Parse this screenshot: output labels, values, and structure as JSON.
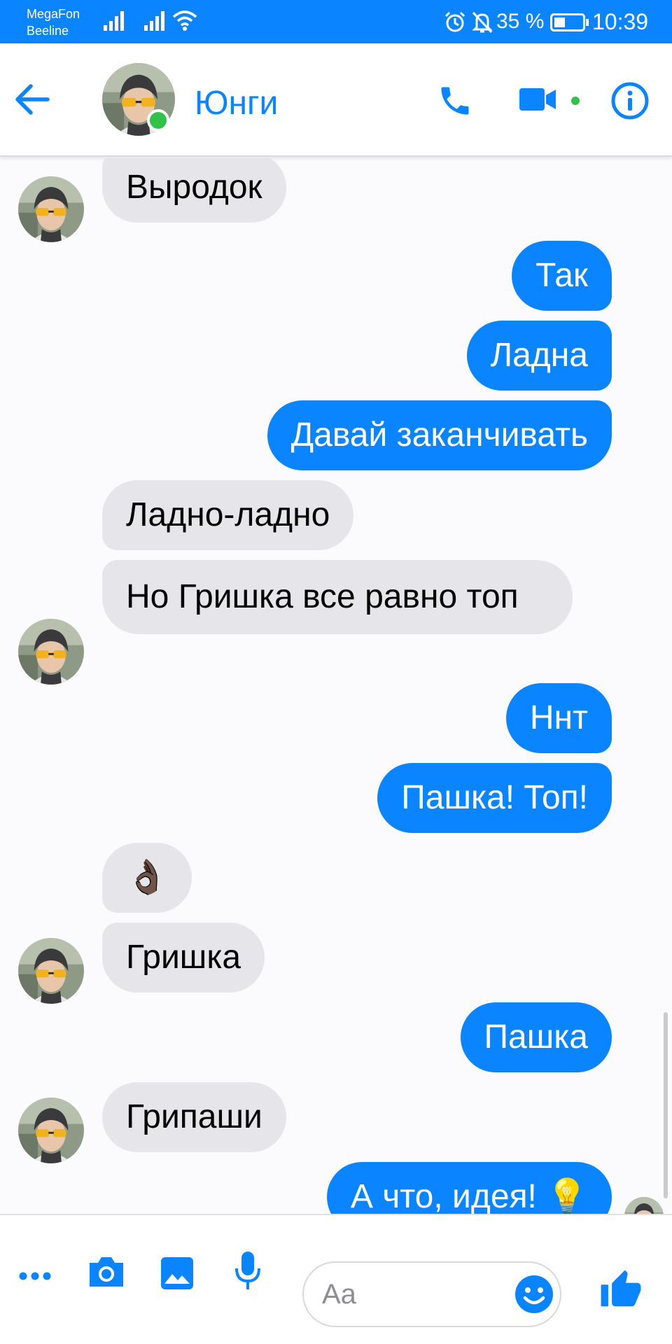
{
  "status_bar": {
    "carrier_1": "MegaFon",
    "carrier_2": "Beeline",
    "battery_percent": "35 %",
    "time": "10:39",
    "icons": [
      "signal-icon",
      "signal-icon",
      "wifi-icon",
      "alarm-icon",
      "notifications-off-icon",
      "battery-icon"
    ]
  },
  "header": {
    "contact_name": "Юнги",
    "online": true,
    "icons": [
      "back-arrow-icon",
      "phone-icon",
      "video-camera-icon",
      "info-icon"
    ]
  },
  "messages": [
    {
      "direction": "in",
      "text": "Выродок"
    },
    {
      "direction": "out",
      "text": "Так"
    },
    {
      "direction": "out",
      "text": "Ладна"
    },
    {
      "direction": "out",
      "text": "Давай заканчивать"
    },
    {
      "direction": "in",
      "text": "Ладно-ладно"
    },
    {
      "direction": "in",
      "text": "Но Гришка все равно топ"
    },
    {
      "direction": "out",
      "text": "Ннт"
    },
    {
      "direction": "out",
      "text": "Пашка! Топ!"
    },
    {
      "direction": "in",
      "text": "👌🏿"
    },
    {
      "direction": "in",
      "text": "Гришка"
    },
    {
      "direction": "out",
      "text": "Пашка"
    },
    {
      "direction": "in",
      "text": "Грипаши"
    },
    {
      "direction": "out",
      "text": "А что, идея! 💡"
    }
  ],
  "composer": {
    "placeholder": "Aa",
    "icons": [
      "more-icon",
      "camera-icon",
      "image-icon",
      "microphone-icon",
      "emoji-icon",
      "thumbs-up-icon"
    ]
  },
  "colors": {
    "accent": "#0a84ff",
    "incoming_bubble": "#e6e6ea",
    "online": "#31c249",
    "background": "#fbfafd"
  }
}
